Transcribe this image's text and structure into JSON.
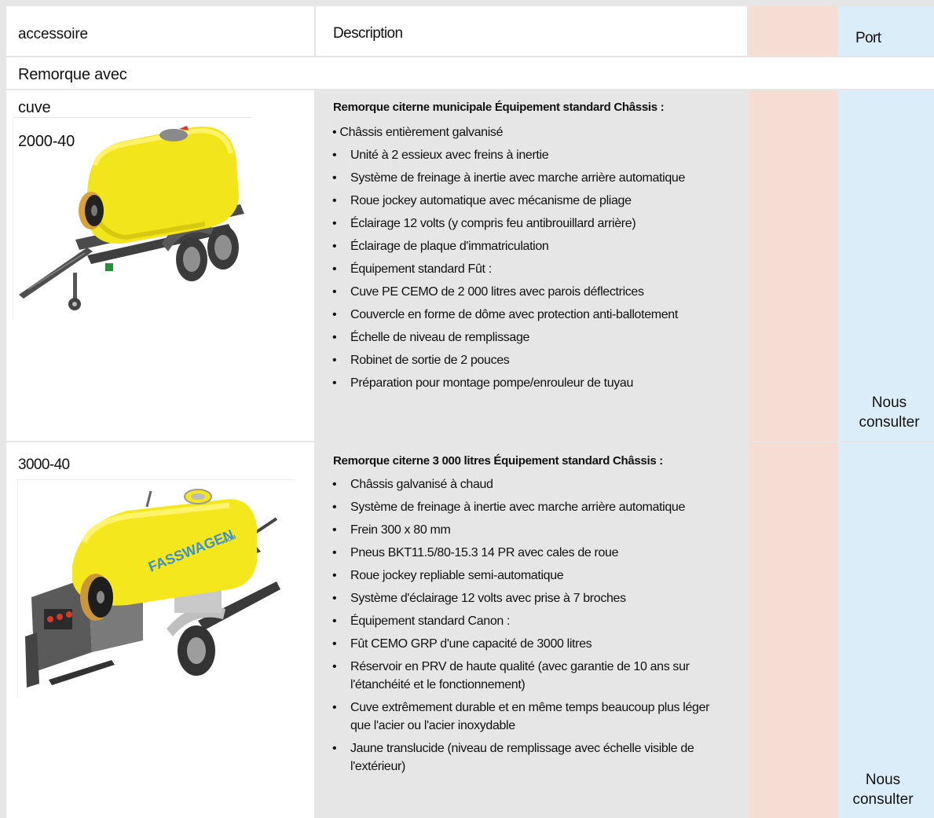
{
  "header": {
    "col1": "accessoire",
    "col2": "Description",
    "col4": "Port"
  },
  "section_title": "Remorque avec",
  "product1": {
    "label_a": "cuve",
    "label_b": "2000-40",
    "heading": "Remorque citerne municipale Équipement standard Châssis :",
    "items": [
      {
        "bullet": "•",
        "text": "Châssis entièrement galvanisé"
      },
      {
        "bullet": "•",
        "text": "Unité à 2 essieux avec freins à inertie"
      },
      {
        "bullet": "•",
        "text": "Système de freinage à inertie avec marche arrière automatique"
      },
      {
        "bullet": "•",
        "text": "Roue jockey automatique avec mécanisme de pliage"
      },
      {
        "bullet": "•",
        "text": "Éclairage 12 volts (y compris feu antibrouillard arrière)"
      },
      {
        "bullet": "•",
        "text": "Éclairage de plaque d'immatriculation"
      },
      {
        "bullet": "•",
        "text": "Équipement standard Fût :"
      },
      {
        "bullet": "•",
        "text": "Cuve PE CEMO de 2 000 litres avec parois déflectrices"
      },
      {
        "bullet": "•",
        "text": "Couvercle en forme de dôme avec protection anti-ballotement"
      },
      {
        "bullet": "•",
        "text": "Échelle de niveau de remplissage"
      },
      {
        "bullet": "•",
        "text": "Robinet de sortie de 2 pouces"
      },
      {
        "bullet": "•",
        "text": "Préparation pour montage pompe/enrouleur de tuyau"
      }
    ],
    "port_line1": "Nous",
    "port_line2": "consulter"
  },
  "product2": {
    "label": "3000-40",
    "heading": "Remorque citerne 3 000 litres  Équipement standard Châssis :",
    "items": [
      {
        "bullet": "•",
        "text": "Châssis galvanisé à chaud"
      },
      {
        "bullet": "•",
        "text": "Système de freinage à inertie avec marche arrière automatique"
      },
      {
        "bullet": "•",
        "text": "Frein 300 x 80 mm"
      },
      {
        "bullet": "•",
        "text": "Pneus BKT11.5/80-15.3 14 PR avec cales de roue"
      },
      {
        "bullet": "•",
        "text": "Roue jockey repliable semi-automatique"
      },
      {
        "bullet": "•",
        "text": "Système d'éclairage 12 volts avec prise à 7 broches"
      },
      {
        "bullet": "•",
        "text": "Équipement standard Canon :"
      },
      {
        "bullet": "•",
        "text": "Fût CEMO GRP d'une capacité de 3000 litres"
      },
      {
        "bullet": "•",
        "text": "Réservoir en PRV de haute qualité (avec garantie de 10 ans sur l'étanchéité et le fonctionnement)"
      },
      {
        "bullet": "•",
        "text": "Cuve extrêmement durable et en même temps beaucoup plus léger que l'acier ou l'acier inoxydable"
      },
      {
        "bullet": "•",
        "text": "Jaune translucide (niveau de remplissage avec échelle visible de l'extérieur)"
      }
    ],
    "tank_brand": "FASSWAGEN",
    "tank_brand_suffix": ".COM",
    "port_line1": "Nous",
    "port_line2": "consulter"
  }
}
